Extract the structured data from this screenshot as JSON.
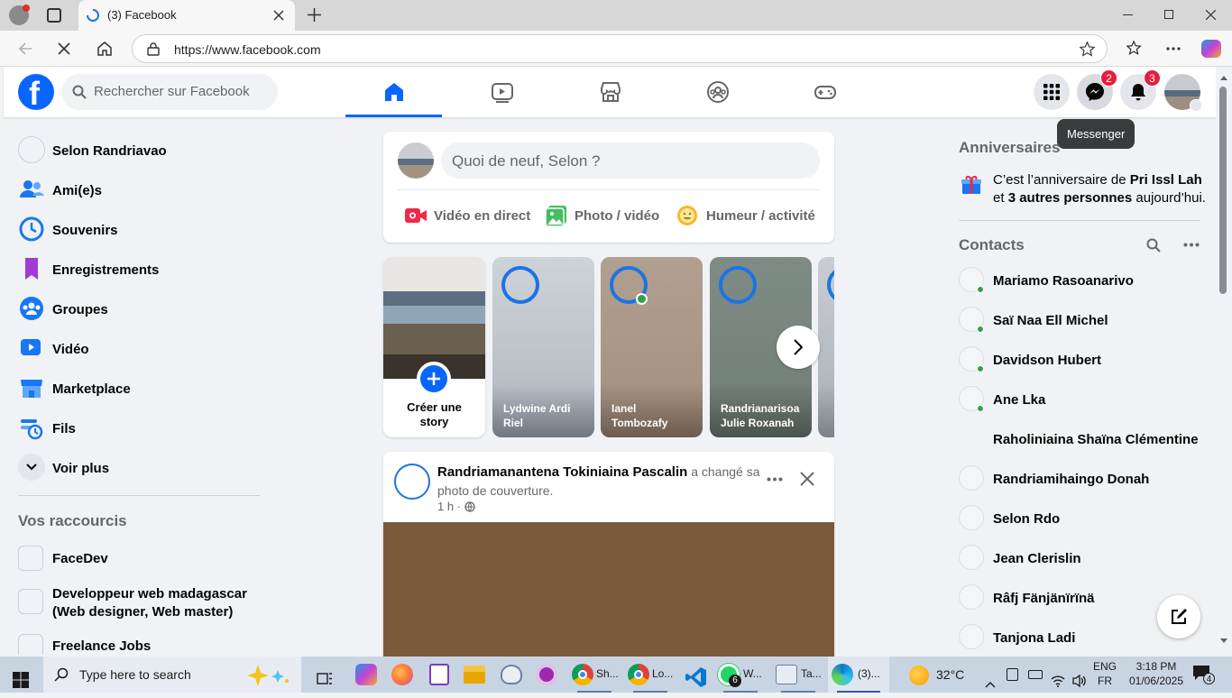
{
  "browser": {
    "tab_title": "(3) Facebook",
    "url": "https://www.facebook.com"
  },
  "header": {
    "search_placeholder": "Rechercher sur Facebook",
    "messenger_badge": "2",
    "notifications_badge": "3",
    "tooltip": "Messenger"
  },
  "left_nav": {
    "items": [
      {
        "label": "Selon Randriavao",
        "icon": "profile-avatar"
      },
      {
        "label": "Ami(e)s",
        "icon": "friends-icon"
      },
      {
        "label": "Souvenirs",
        "icon": "memories-icon"
      },
      {
        "label": "Enregistrements",
        "icon": "saved-icon"
      },
      {
        "label": "Groupes",
        "icon": "groups-icon"
      },
      {
        "label": "Vidéo",
        "icon": "video-icon"
      },
      {
        "label": "Marketplace",
        "icon": "marketplace-icon"
      },
      {
        "label": "Fils",
        "icon": "feeds-icon"
      },
      {
        "label": "Voir plus",
        "icon": "chevron-down-icon"
      }
    ],
    "shortcuts_title": "Vos raccourcis",
    "shortcuts": [
      {
        "label": "FaceDev"
      },
      {
        "label": "Developpeur web madagascar (Web designer, Web master)"
      },
      {
        "label": "Freelance Jobs"
      }
    ]
  },
  "composer": {
    "placeholder": "Quoi de neuf, Selon ?",
    "live_label": "Vidéo en direct",
    "photo_label": "Photo / vidéo",
    "feeling_label": "Humeur / activité"
  },
  "stories": {
    "create_label": "Créer une story",
    "items": [
      {
        "name": "Lydwine Ardi Riel"
      },
      {
        "name": "Ianel Tombozafy"
      },
      {
        "name": "Randrianarisoa Julie Roxanah"
      }
    ]
  },
  "post": {
    "author": "Randriamanantena Tokiniaina Pascalin",
    "action": " a changé sa photo de couverture.",
    "time": "1 h ·"
  },
  "right": {
    "birthdays_title": "Anniversaires",
    "birthday_text_1": "C’est l’anniversaire de ",
    "birthday_name": "Pri Issl Lah",
    "birthday_text_2": "et ",
    "birthday_others": "3 autres personnes",
    "birthday_text_3": " aujourd’hui.",
    "contacts_title": "Contacts",
    "contacts": [
      {
        "name": "Mariamo Rasoanarivo",
        "online": true
      },
      {
        "name": "Saï Naa Ell Michel",
        "online": true
      },
      {
        "name": "Davidson Hubert",
        "online": true
      },
      {
        "name": "Ane Lka",
        "online": true
      },
      {
        "name": "Raholiniaina Shaïna Clémentine",
        "online": false
      },
      {
        "name": "Randriamihaingo Donah",
        "online": false
      },
      {
        "name": "Selon Rdo",
        "online": false
      },
      {
        "name": "Jean Clerislin",
        "online": false
      },
      {
        "name": "Râfj Fänjänïrïnä",
        "online": false
      },
      {
        "name": "Tanjona Ladi",
        "online": false
      }
    ]
  },
  "taskbar": {
    "search_placeholder": "Type here to search",
    "apps": [
      {
        "label": "Sh..."
      },
      {
        "label": "Lo..."
      },
      {
        "label": "W..."
      },
      {
        "label": "Ta..."
      },
      {
        "label": "(3)..."
      }
    ],
    "weather": "32°C",
    "lang_1": "ENG",
    "lang_2": "FR",
    "time": "3:18 PM",
    "date": "01/06/2025",
    "notif_count": "4",
    "whatsapp_badge": "6"
  },
  "colors": {
    "fb_blue": "#0866ff",
    "accent": "#1877f2",
    "online": "#31a24c",
    "badge": "#e41e3f"
  }
}
